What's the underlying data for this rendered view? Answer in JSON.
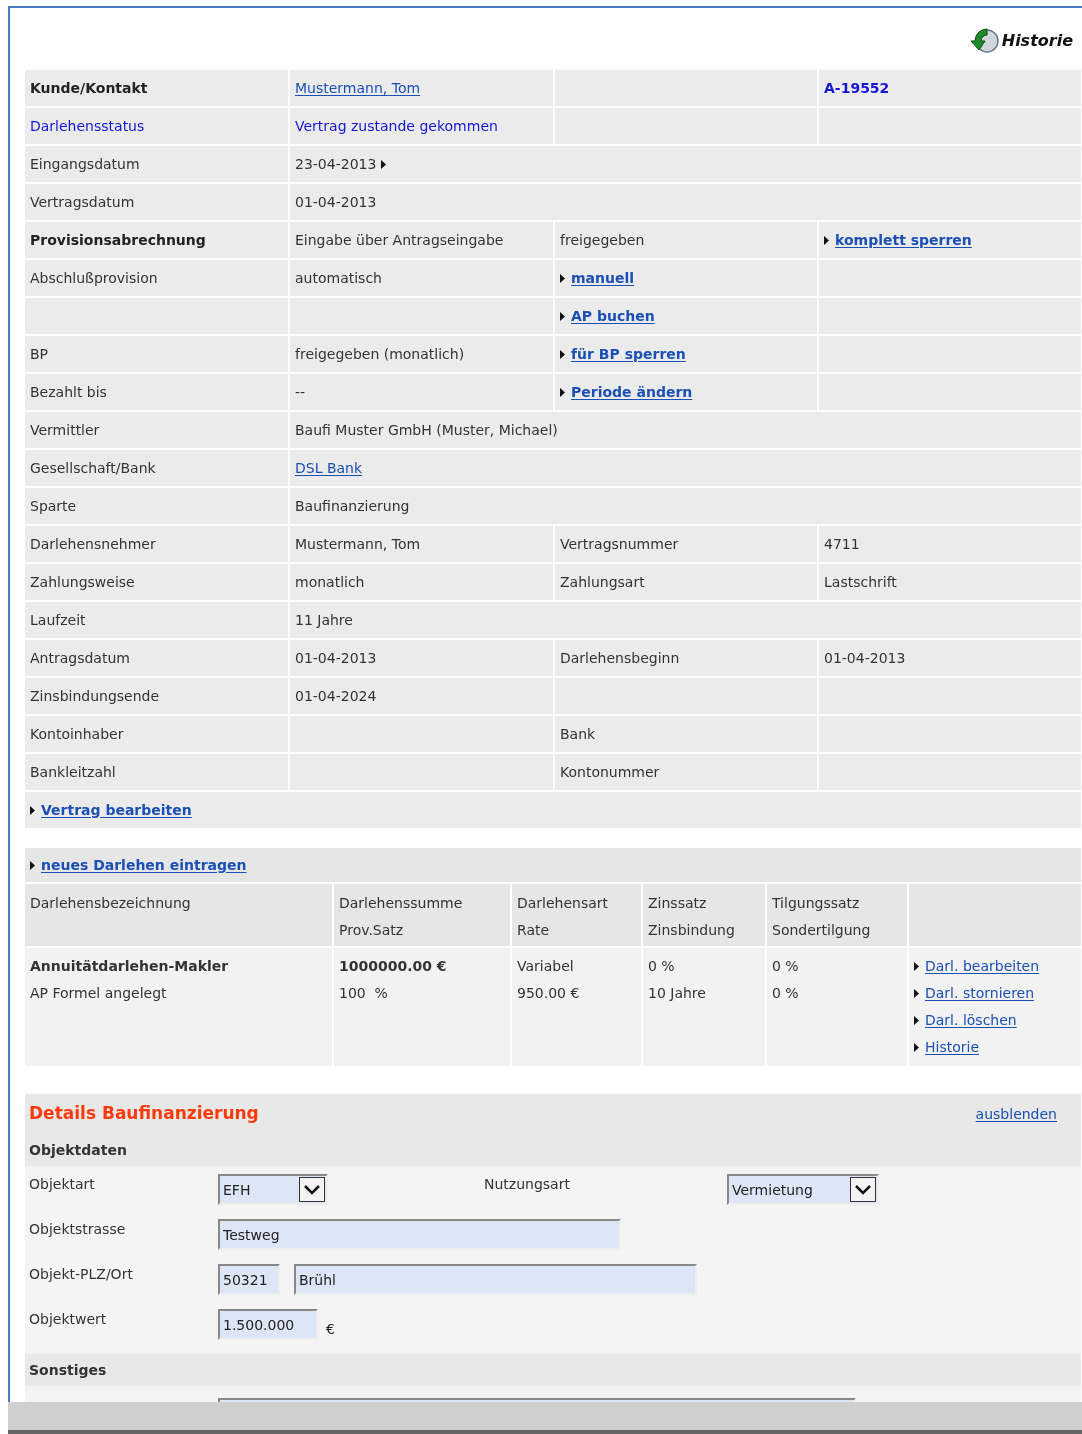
{
  "header": {
    "history_label": "Historie"
  },
  "contract": {
    "rows": [
      {
        "cells": [
          {
            "kind": "label_bold",
            "text": "Kunde/Kontakt"
          },
          {
            "kind": "link",
            "text": "Mustermann, Tom"
          },
          {
            "kind": "empty"
          },
          {
            "kind": "code",
            "text": "A-19552"
          }
        ]
      },
      {
        "cells": [
          {
            "kind": "label_blue",
            "text": "Darlehensstatus"
          },
          {
            "kind": "text_blue",
            "text": "Vertrag zustande gekommen"
          },
          {
            "kind": "empty"
          },
          {
            "kind": "empty"
          }
        ]
      },
      {
        "cells": [
          {
            "kind": "label",
            "text": "Eingangsdatum"
          },
          {
            "kind": "date_menu",
            "text": "23-04-2013"
          }
        ]
      },
      {
        "cells": [
          {
            "kind": "label",
            "text": "Vertragsdatum"
          },
          {
            "kind": "text",
            "text": "01-04-2013"
          }
        ]
      },
      {
        "cells": [
          {
            "kind": "label_bold",
            "text": "Provisionsabrechnung"
          },
          {
            "kind": "text",
            "text": "Eingabe über Antragseingabe"
          },
          {
            "kind": "text",
            "text": "freigegeben"
          },
          {
            "kind": "action",
            "text": "komplett sperren"
          }
        ]
      },
      {
        "cells": [
          {
            "kind": "label",
            "text": "Abschlußprovision"
          },
          {
            "kind": "text",
            "text": "automatisch"
          },
          {
            "kind": "action",
            "text": "manuell"
          },
          {
            "kind": "empty"
          }
        ]
      },
      {
        "cells": [
          {
            "kind": "empty"
          },
          {
            "kind": "empty"
          },
          {
            "kind": "action",
            "text": "AP buchen"
          },
          {
            "kind": "empty"
          }
        ]
      },
      {
        "cells": [
          {
            "kind": "label",
            "text": "BP"
          },
          {
            "kind": "text",
            "text": "freigegeben (monatlich)"
          },
          {
            "kind": "action",
            "text": "für BP sperren"
          },
          {
            "kind": "empty"
          }
        ]
      },
      {
        "cells": [
          {
            "kind": "label",
            "text": "Bezahlt bis"
          },
          {
            "kind": "text",
            "text": "--"
          },
          {
            "kind": "action",
            "text": "Periode ändern"
          },
          {
            "kind": "empty"
          }
        ]
      },
      {
        "cells": [
          {
            "kind": "label",
            "text": "Vermittler"
          },
          {
            "kind": "text",
            "text": "Baufi Muster GmbH (Muster, Michael)"
          }
        ]
      },
      {
        "cells": [
          {
            "kind": "label",
            "text": "Gesellschaft/Bank"
          },
          {
            "kind": "link",
            "text": "DSL Bank"
          }
        ]
      },
      {
        "cells": [
          {
            "kind": "label",
            "text": "Sparte"
          },
          {
            "kind": "text",
            "text": "Baufinanzierung"
          }
        ]
      },
      {
        "cells": [
          {
            "kind": "label",
            "text": "Darlehensnehmer"
          },
          {
            "kind": "text",
            "text": "Mustermann, Tom"
          },
          {
            "kind": "text",
            "text": "Vertragsnummer"
          },
          {
            "kind": "text",
            "text": "4711"
          }
        ]
      },
      {
        "cells": [
          {
            "kind": "label",
            "text": "Zahlungsweise"
          },
          {
            "kind": "text",
            "text": "monatlich"
          },
          {
            "kind": "text",
            "text": "Zahlungsart"
          },
          {
            "kind": "text",
            "text": "Lastschrift"
          }
        ]
      },
      {
        "cells": [
          {
            "kind": "label",
            "text": "Laufzeit"
          },
          {
            "kind": "text",
            "text": "11 Jahre"
          }
        ]
      },
      {
        "cells": [
          {
            "kind": "label",
            "text": "Antragsdatum"
          },
          {
            "kind": "text",
            "text": "01-04-2013"
          },
          {
            "kind": "text",
            "text": "Darlehensbeginn"
          },
          {
            "kind": "text",
            "text": "01-04-2013"
          }
        ]
      },
      {
        "cells": [
          {
            "kind": "label",
            "text": "Zinsbindungsende"
          },
          {
            "kind": "text",
            "text": "01-04-2024"
          },
          {
            "kind": "empty"
          },
          {
            "kind": "empty"
          }
        ]
      },
      {
        "cells": [
          {
            "kind": "label",
            "text": "Kontoinhaber"
          },
          {
            "kind": "empty"
          },
          {
            "kind": "text",
            "text": "Bank"
          },
          {
            "kind": "empty"
          }
        ]
      },
      {
        "cells": [
          {
            "kind": "label",
            "text": "Bankleitzahl"
          },
          {
            "kind": "empty"
          },
          {
            "kind": "text",
            "text": "Kontonummer"
          },
          {
            "kind": "empty"
          }
        ]
      }
    ],
    "edit_action": "Vertrag bearbeiten"
  },
  "loans": {
    "add_action": "neues Darlehen eintragen",
    "columns": [
      "Darlehensbezeichnung",
      "Darlehenssumme\nProv.Satz",
      "Darlehensart\nRate",
      "Zinssatz\nZinsbindung",
      "Tilgungssatz\nSondertilgung"
    ],
    "rows": [
      {
        "cells": [
          "**Annuitätdarlehen-Makler**\nAP Formel angelegt",
          "**1000000.00 €**\n100  %",
          "Variabel\n950.00 €",
          "0 %\n10 Jahre",
          "0 %\n0 %"
        ],
        "actions": [
          "Darl. bearbeiten",
          "Darl. stornieren",
          "Darl. löschen",
          "Historie"
        ]
      }
    ]
  },
  "details": {
    "title": "Details Baufinanzierung",
    "hide_action": "ausblenden",
    "groups": [
      {
        "title": "Objektdaten",
        "rows": [
          {
            "items": [
              {
                "kind": "label",
                "text": "Objektart"
              },
              {
                "kind": "select",
                "value": "EFH"
              },
              {
                "kind": "label",
                "text": "Nutzungsart"
              },
              {
                "kind": "select",
                "value": "Vermietung"
              }
            ]
          },
          {
            "items": [
              {
                "kind": "label",
                "text": "Objektstrasse"
              },
              {
                "kind": "input",
                "value": "Testweg"
              }
            ]
          },
          {
            "items": [
              {
                "kind": "label",
                "text": "Objekt-PLZ/Ort"
              },
              {
                "kind": "input",
                "value": "50321"
              },
              {
                "kind": "input",
                "value": "Brühl"
              }
            ]
          },
          {
            "items": [
              {
                "kind": "label",
                "text": "Objektwert"
              },
              {
                "kind": "input",
                "value": "1.500.000"
              },
              {
                "kind": "unit",
                "text": "€"
              }
            ]
          }
        ]
      },
      {
        "title": "Sonstiges",
        "rows": [
          {
            "items": [
              {
                "kind": "textarea"
              }
            ]
          }
        ]
      }
    ]
  }
}
